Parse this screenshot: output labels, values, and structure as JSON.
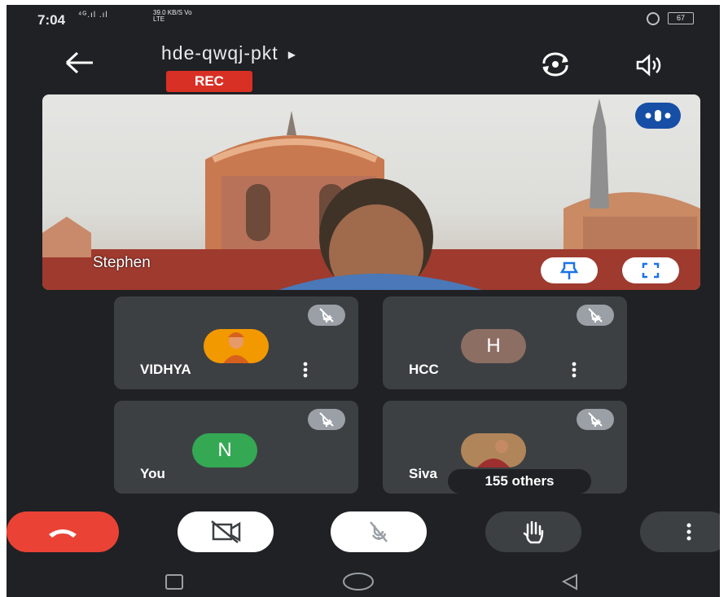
{
  "status_bar": {
    "time": "7:04",
    "signal_text": "⁴ᴳ.ıl .ıl",
    "net_speed": "39.0 KB/S",
    "net_type": "Vo LTE",
    "battery": "67"
  },
  "header": {
    "meeting_code": "hde-qwqj-pkt",
    "rec_label": "REC"
  },
  "main_video": {
    "speaker_name": "Stephen"
  },
  "participants": [
    {
      "name": "VIDHYA",
      "initial": "",
      "avatar_color": "#f29900"
    },
    {
      "name": "HCC",
      "initial": "H",
      "avatar_color": "#8d6e63"
    },
    {
      "name": "You",
      "initial": "N",
      "avatar_color": "#34a853"
    },
    {
      "name": "Siva",
      "initial": "",
      "avatar_color": "#b0855a",
      "others_label": "155 others"
    }
  ],
  "colors": {
    "end_call": "#ea4335",
    "control_dark": "#3c4043",
    "control_light": "#ffffff",
    "rec": "#d93025"
  },
  "icons": [
    "back-arrow-icon",
    "flip-camera-icon",
    "speaker-icon",
    "pin-icon",
    "fullscreen-icon",
    "mic-off-icon",
    "more-vert-icon",
    "hang-up-icon",
    "camera-off-icon",
    "raise-hand-icon",
    "nav-square-icon",
    "nav-circle-icon",
    "nav-back-triangle-icon"
  ]
}
